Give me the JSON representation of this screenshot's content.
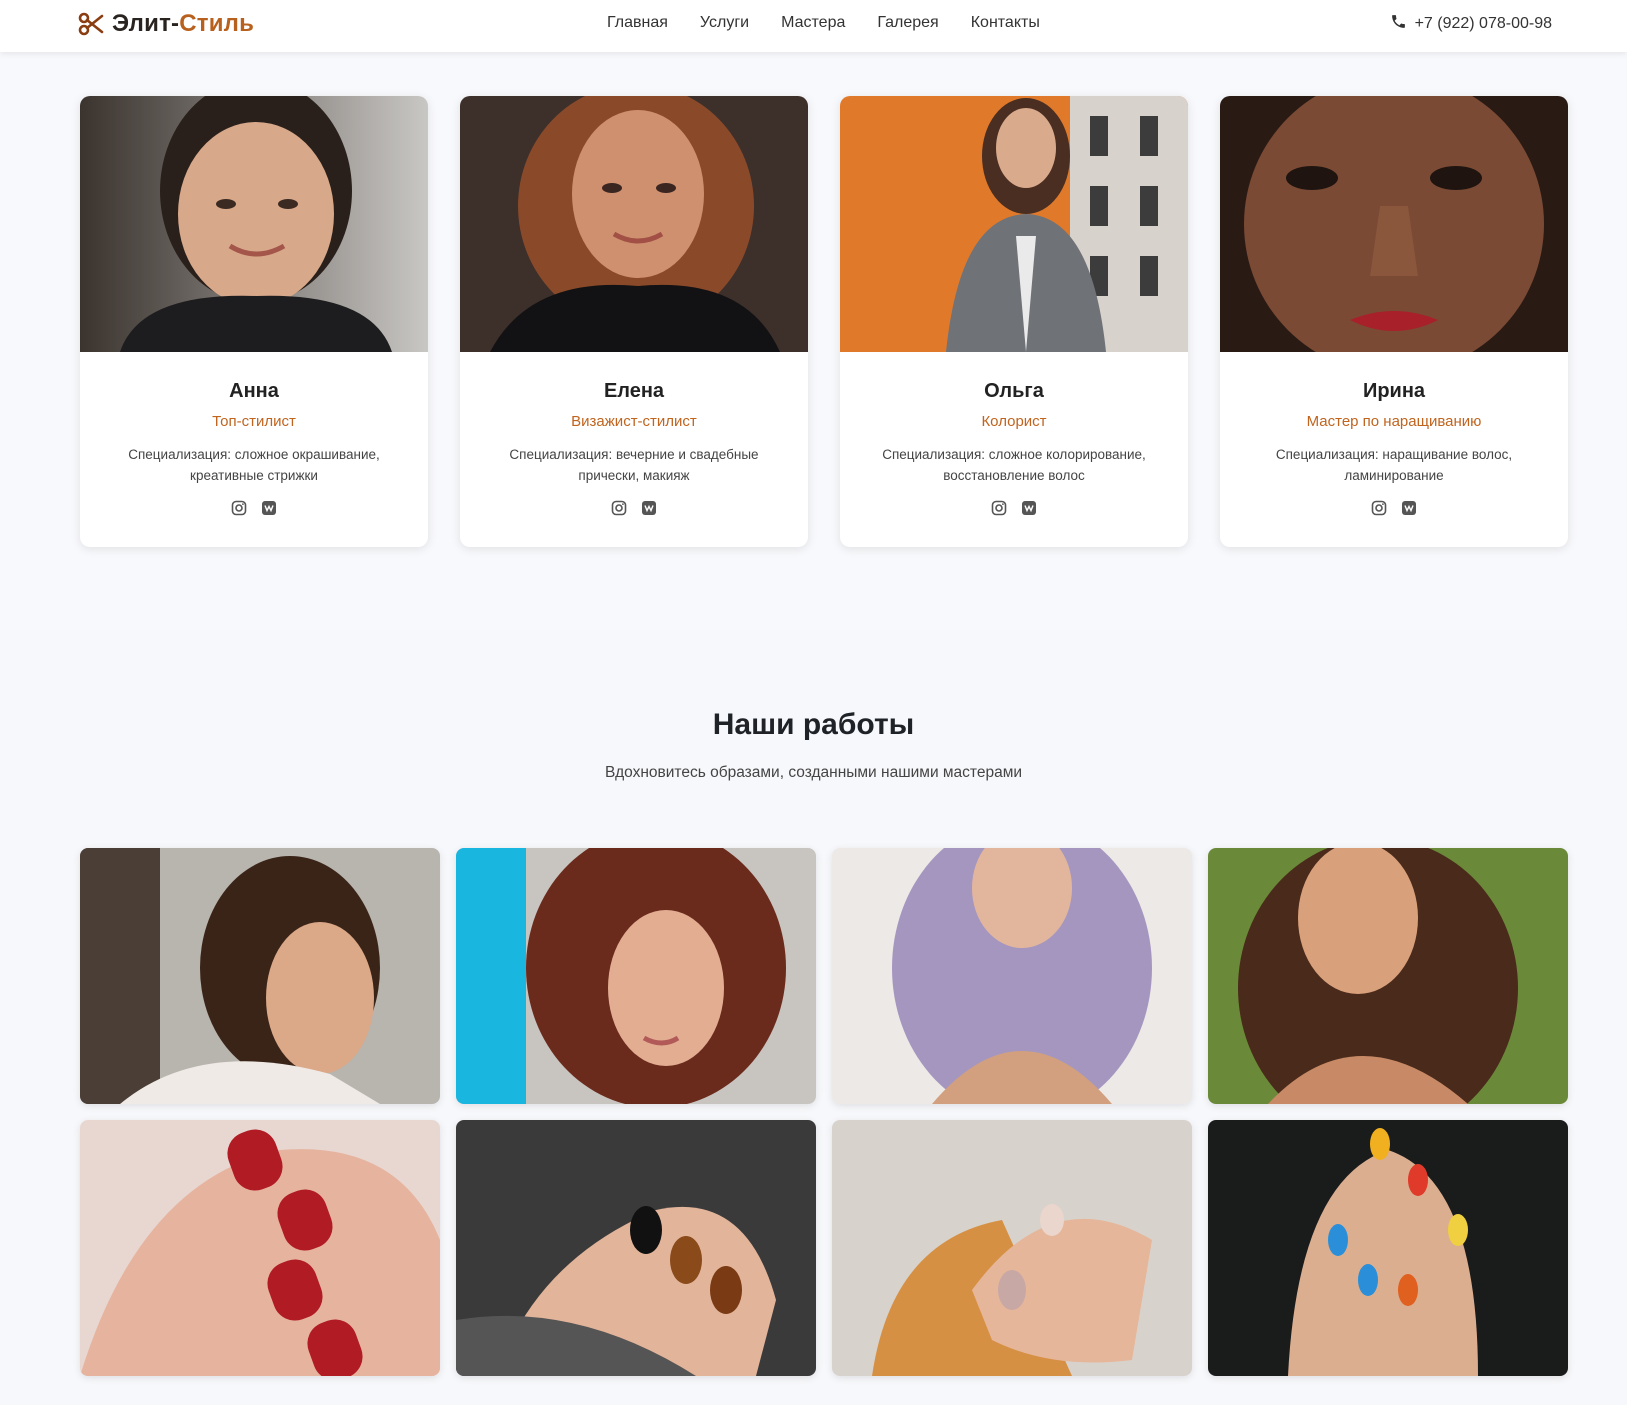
{
  "header": {
    "logo_part1": "Элит-",
    "logo_part2": "Стиль",
    "nav": [
      "Главная",
      "Услуги",
      "Мастера",
      "Галерея",
      "Контакты"
    ],
    "phone": "+7 (922) 078-00-98"
  },
  "masters": [
    {
      "name": "Анна",
      "role": "Топ-стилист",
      "spec": "Специализация: сложное окрашивание, креативные стрижки",
      "socials": [
        "instagram-icon",
        "vk-icon"
      ]
    },
    {
      "name": "Елена",
      "role": "Визажист-стилист",
      "spec": "Специализация: вечерние и свадебные прически, макияж",
      "socials": [
        "instagram-icon",
        "vk-icon"
      ]
    },
    {
      "name": "Ольга",
      "role": "Колорист",
      "spec": "Специализация: сложное колорирование, восстановление волос",
      "socials": [
        "instagram-icon",
        "vk-icon"
      ]
    },
    {
      "name": "Ирина",
      "role": "Мастер по наращиванию",
      "spec": "Специализация: наращивание волос, ламинирование",
      "socials": [
        "instagram-icon",
        "vk-icon"
      ]
    }
  ],
  "works": {
    "title": "Наши работы",
    "subtitle": "Вдохновитесь образами, созданными нашими мастерами"
  },
  "colors": {
    "accent": "#c0641e",
    "logo_dark": "#2a2420",
    "background": "#f8f9fc"
  }
}
